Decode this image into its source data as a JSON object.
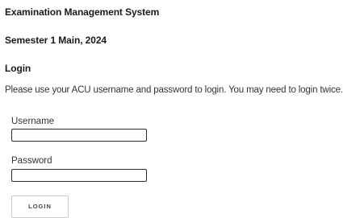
{
  "page": {
    "system_title": "Examination Management System",
    "semester": "Semester 1 Main, 2024",
    "section_title": "Login",
    "instructions": "Please use your ACU username and password to login. You may need to login twice."
  },
  "form": {
    "username_label": "Username",
    "username_value": "",
    "password_label": "Password",
    "password_value": "",
    "login_button_label": "LOGIN"
  }
}
